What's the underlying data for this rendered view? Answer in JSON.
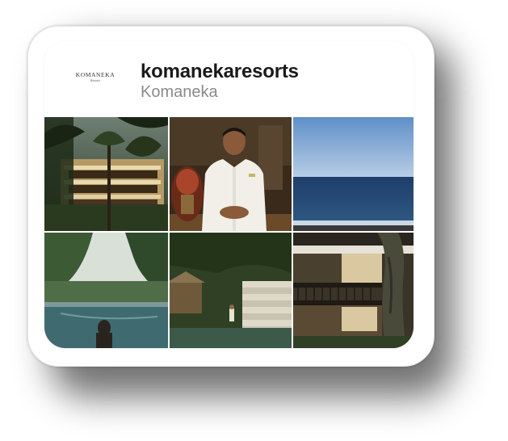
{
  "profile": {
    "logo_text": "KOMANEKA",
    "logo_subtext": "Resorts",
    "username": "komanekaresorts",
    "display_name": "Komaneka"
  },
  "grid": {
    "photos": [
      {
        "name": "photo-jungle-villa-building"
      },
      {
        "name": "photo-staff-portrait"
      },
      {
        "name": "photo-ocean-horizon"
      },
      {
        "name": "photo-infinity-pool-jungle"
      },
      {
        "name": "photo-garden-stairs"
      },
      {
        "name": "photo-villa-balcony-tree"
      }
    ]
  },
  "colors": {
    "card_background": "#ffffff",
    "username_color": "#1a1a1a",
    "display_name_color": "#8a8a8a"
  }
}
